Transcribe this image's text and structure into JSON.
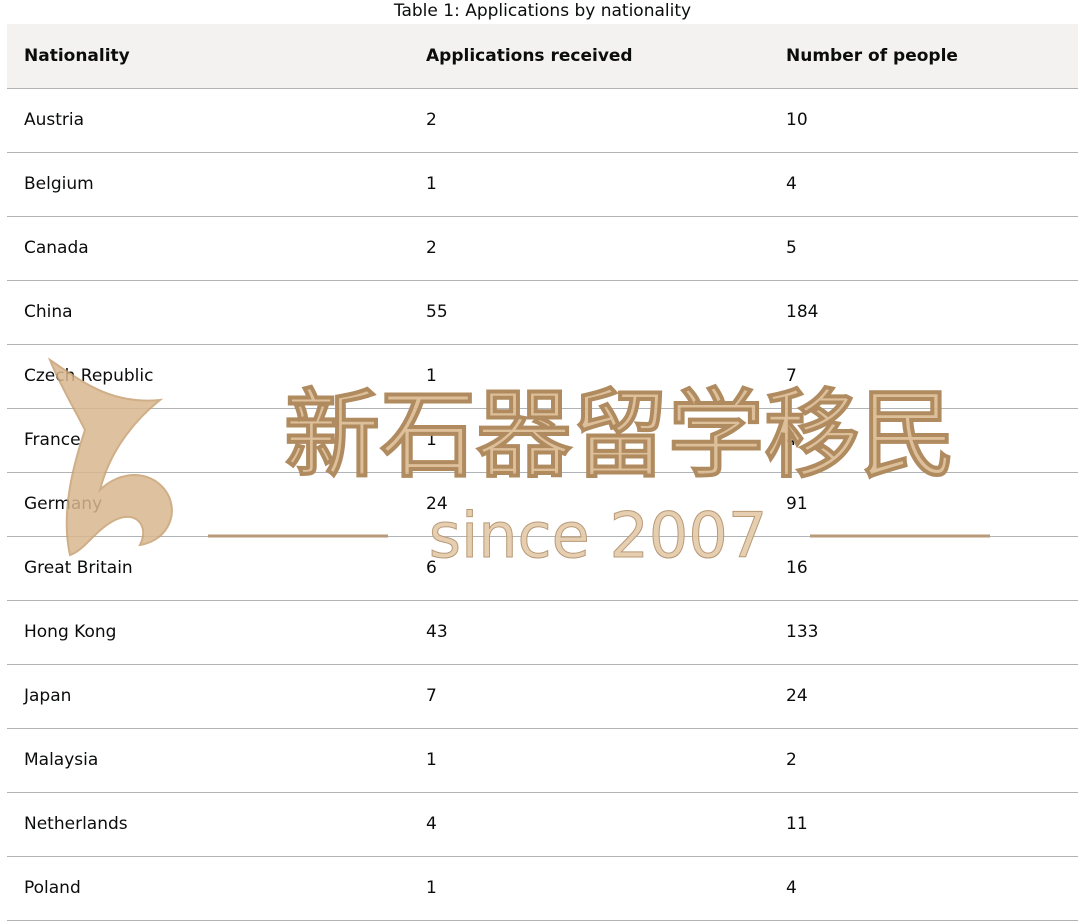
{
  "table": {
    "caption": "Table 1: Applications by nationality",
    "headers": [
      "Nationality",
      "Applications received",
      "Number of people"
    ],
    "rows": [
      [
        "Austria",
        "2",
        "10"
      ],
      [
        "Belgium",
        "1",
        "4"
      ],
      [
        "Canada",
        "2",
        "5"
      ],
      [
        "China",
        "55",
        "184"
      ],
      [
        "Czech Republic",
        "1",
        "7"
      ],
      [
        "France",
        "1",
        "4"
      ],
      [
        "Germany",
        "24",
        "91"
      ],
      [
        "Great Britain",
        "6",
        "16"
      ],
      [
        "Hong Kong",
        "43",
        "133"
      ],
      [
        "Japan",
        "7",
        "24"
      ],
      [
        "Malaysia",
        "1",
        "2"
      ],
      [
        "Netherlands",
        "4",
        "11"
      ],
      [
        "Poland",
        "1",
        "4"
      ]
    ]
  },
  "watermark": {
    "text_cn": "新石器留学移民",
    "text_en": "since 2007",
    "color": "#d9b88f"
  },
  "colors": {
    "header_bg": "#f3f2f1",
    "row_border": "#b1b4b6",
    "text": "#0b0c0c"
  }
}
